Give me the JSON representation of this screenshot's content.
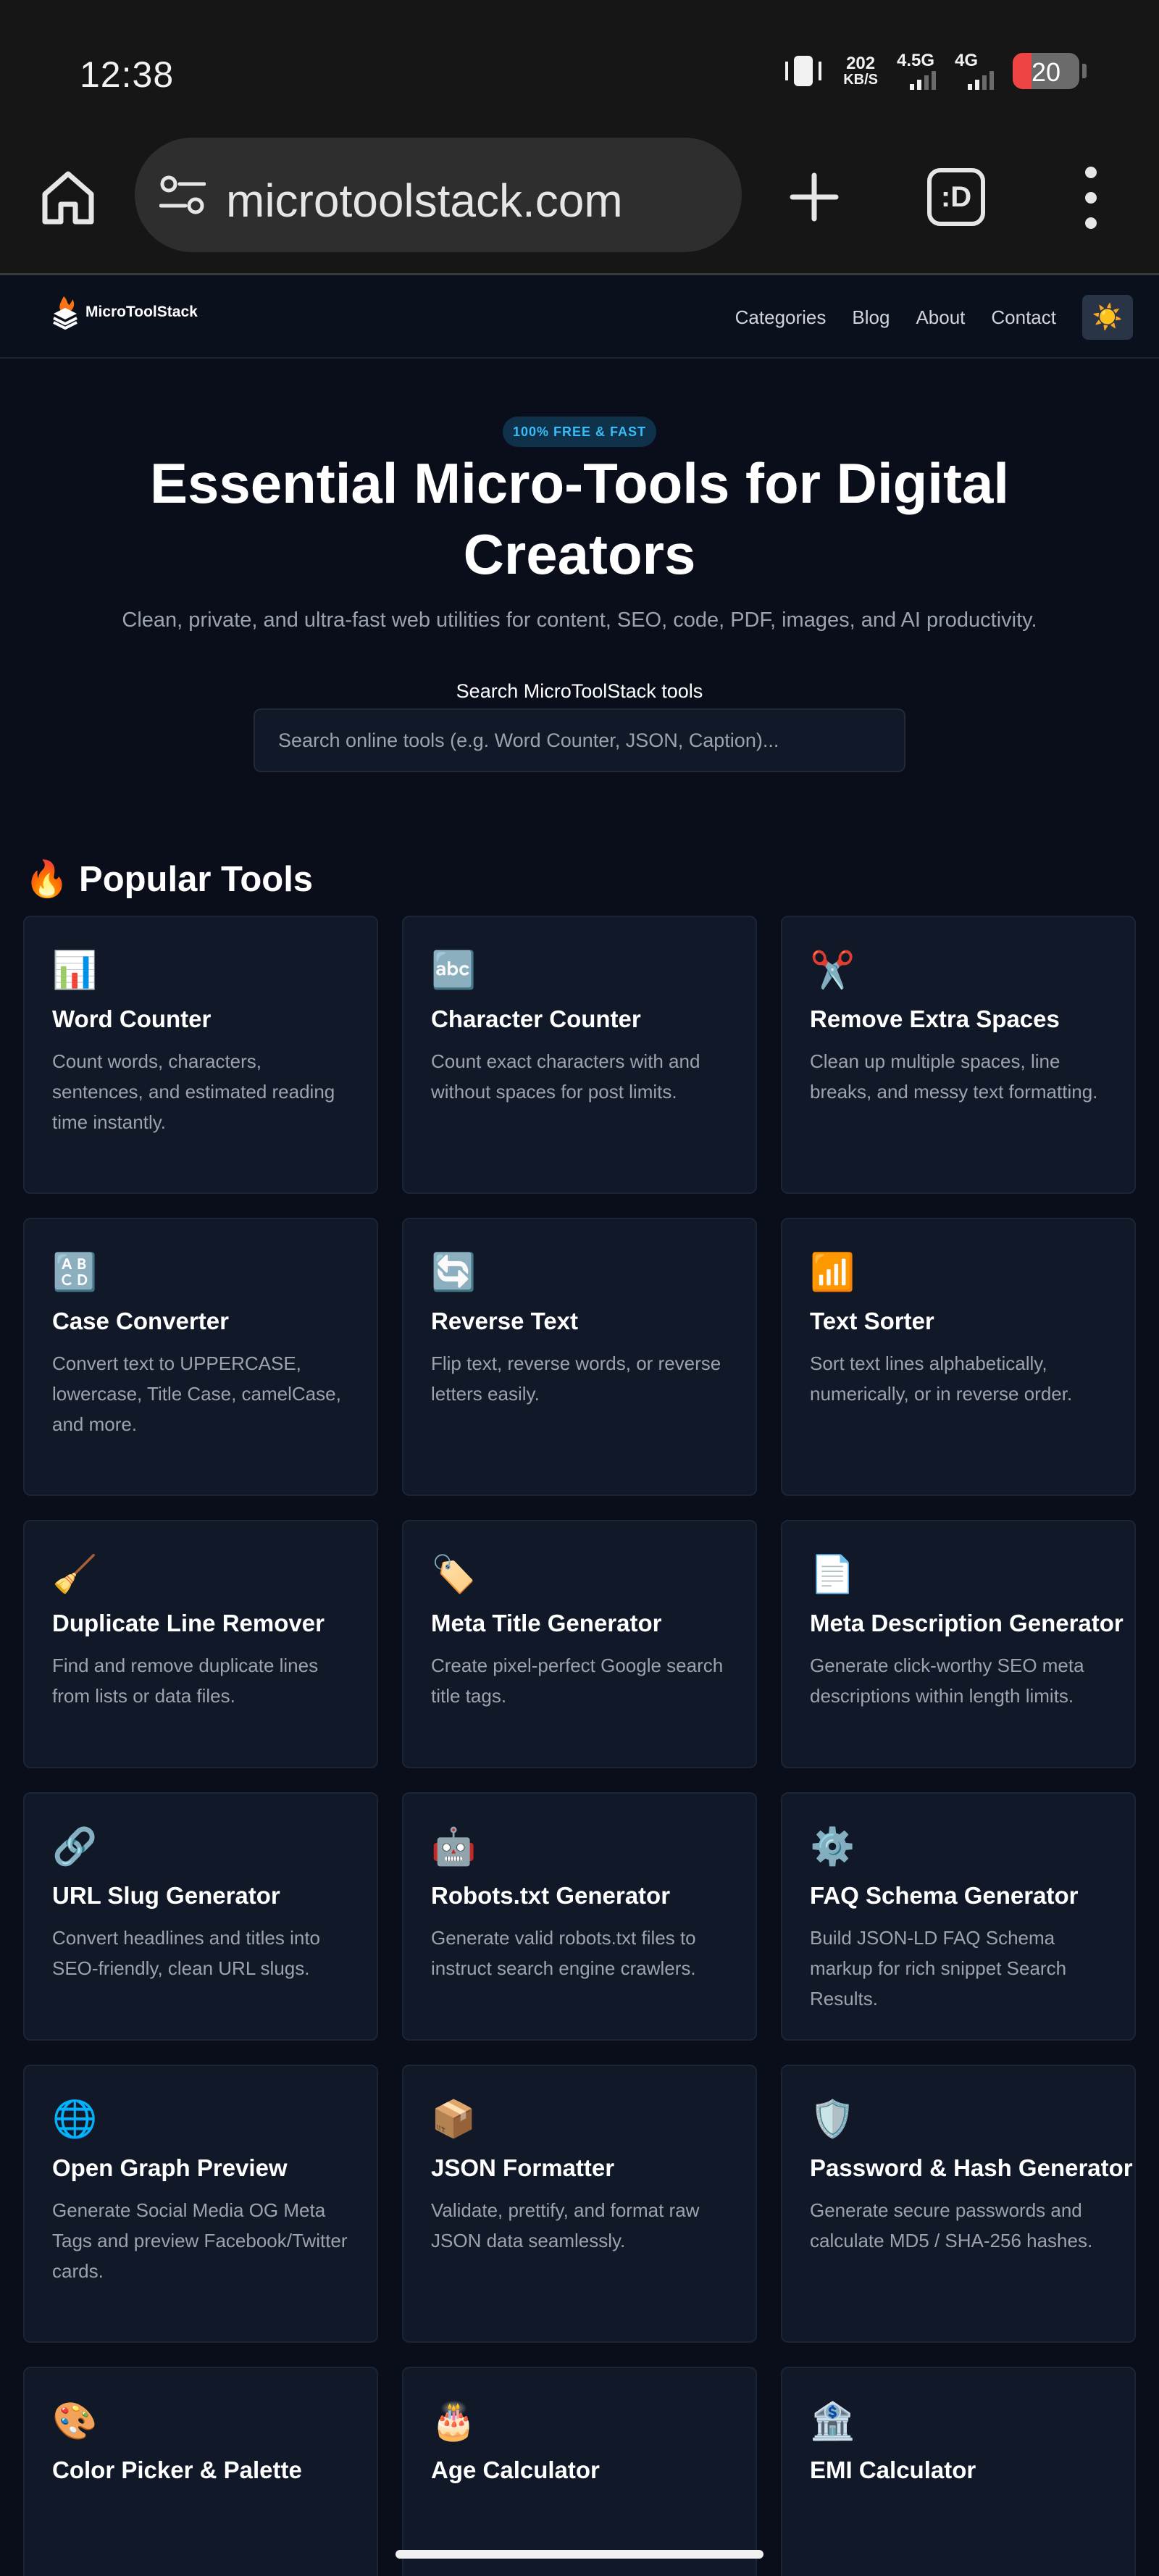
{
  "status_bar": {
    "time": "12:38",
    "net_speed_value": "202",
    "net_speed_unit": "KB/S",
    "signal1_label": "4.5G",
    "signal2_label": "4G",
    "battery": "20"
  },
  "browser": {
    "url": "microtoolstack.com",
    "tabs_label": ":D"
  },
  "site": {
    "logo_text": "MicroToolStack",
    "nav": [
      "Categories",
      "Blog",
      "About",
      "Contact"
    ],
    "theme_icon": "☀️"
  },
  "hero": {
    "badge": "100% FREE & FAST",
    "title_line1": "Essential Micro-Tools for Digital",
    "title_line2": "Creators",
    "subtitle": "Clean, private, and ultra-fast web utilities for content, SEO, code, PDF, images, and AI productivity.",
    "search_label": "Search MicroToolStack tools",
    "search_placeholder": "Search online tools (e.g. Word Counter, JSON, Caption)..."
  },
  "popular": {
    "icon": "🔥",
    "title": "Popular Tools",
    "tools": [
      {
        "icon": "📊",
        "name": "Word Counter",
        "desc": "Count words, characters, sentences, and estimated reading time instantly."
      },
      {
        "icon": "🔤",
        "name": "Character Counter",
        "desc": "Count exact characters with and without spaces for post limits."
      },
      {
        "icon": "✂️",
        "name": "Remove Extra Spaces",
        "desc": "Clean up multiple spaces, line breaks, and messy text formatting."
      },
      {
        "icon": "🔠",
        "name": "Case Converter",
        "desc": "Convert text to UPPERCASE, lowercase, Title Case, camelCase, and more."
      },
      {
        "icon": "🔄",
        "name": "Reverse Text",
        "desc": "Flip text, reverse words, or reverse letters easily."
      },
      {
        "icon": "📶",
        "name": "Text Sorter",
        "desc": "Sort text lines alphabetically, numerically, or in reverse order."
      },
      {
        "icon": "🧹",
        "name": "Duplicate Line Remover",
        "desc": "Find and remove duplicate lines from lists or data files."
      },
      {
        "icon": "🏷️",
        "name": "Meta Title Generator",
        "desc": "Create pixel-perfect Google search title tags."
      },
      {
        "icon": "📄",
        "name": "Meta Description Generator",
        "desc": "Generate click-worthy SEO meta descriptions within length limits."
      },
      {
        "icon": "🔗",
        "name": "URL Slug Generator",
        "desc": "Convert headlines and titles into SEO-friendly, clean URL slugs."
      },
      {
        "icon": "🤖",
        "name": "Robots.txt Generator",
        "desc": "Generate valid robots.txt files to instruct search engine crawlers."
      },
      {
        "icon": "⚙️",
        "name": "FAQ Schema Generator",
        "desc": "Build JSON-LD FAQ Schema markup for rich snippet Search Results."
      },
      {
        "icon": "🌐",
        "name": "Open Graph Preview",
        "desc": "Generate Social Media OG Meta Tags and preview Facebook/Twitter cards."
      },
      {
        "icon": "📦",
        "name": "JSON Formatter",
        "desc": "Validate, prettify, and format raw JSON data seamlessly."
      },
      {
        "icon": "🛡️",
        "name": "Password & Hash Generator",
        "desc": "Generate secure passwords and calculate MD5 / SHA-256 hashes."
      },
      {
        "icon": "🎨",
        "name": "Color Picker & Palette",
        "desc": ""
      },
      {
        "icon": "🎂",
        "name": "Age Calculator",
        "desc": ""
      },
      {
        "icon": "🏦",
        "name": "EMI Calculator",
        "desc": ""
      }
    ]
  }
}
